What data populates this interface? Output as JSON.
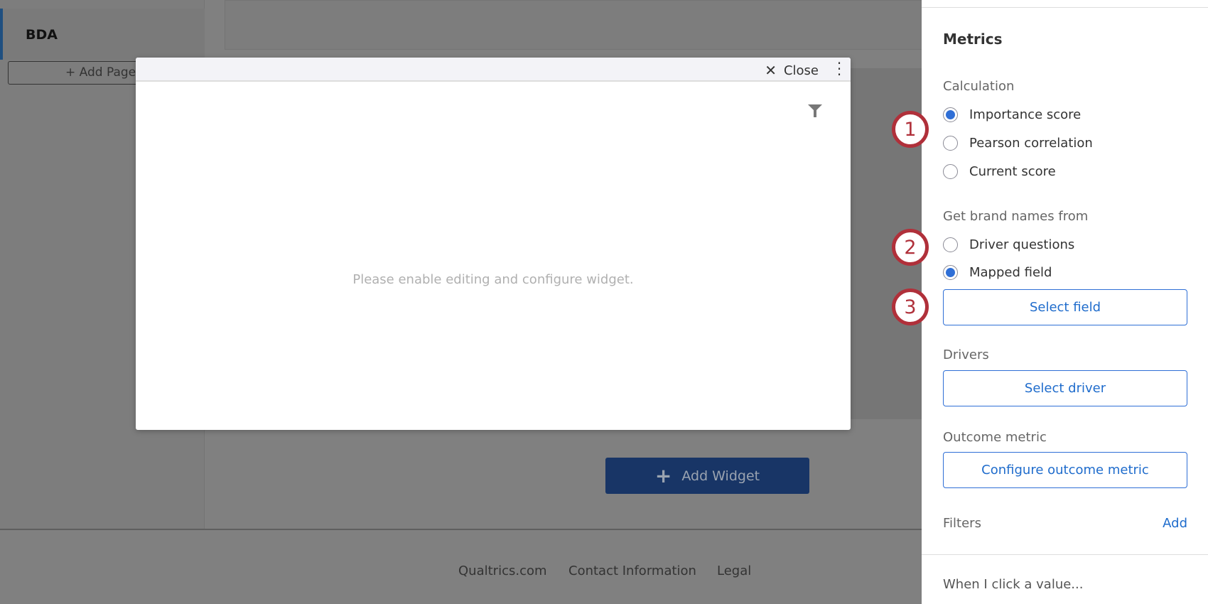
{
  "sidebar": {
    "active_page": "BDA",
    "add_page": "Add Page"
  },
  "main": {
    "add_widget": "Add Widget"
  },
  "footer": {
    "links": [
      "Qualtrics.com",
      "Contact Information",
      "Legal"
    ]
  },
  "modal": {
    "close": "Close",
    "message": "Please enable editing and configure widget."
  },
  "panel": {
    "title": "Metrics",
    "calculation_label": "Calculation",
    "calculation_options": [
      "Importance score",
      "Pearson correlation",
      "Current score"
    ],
    "calculation_selected": "Importance score",
    "brand_label": "Get brand names from",
    "brand_options": [
      "Driver questions",
      "Mapped field"
    ],
    "brand_selected": "Mapped field",
    "select_field": "Select field",
    "drivers_label": "Drivers",
    "select_driver": "Select driver",
    "outcome_label": "Outcome metric",
    "configure_outcome": "Configure outcome metric",
    "filters_label": "Filters",
    "filters_add": "Add",
    "click_label": "When I click a value..."
  },
  "callouts": [
    "1",
    "2",
    "3"
  ],
  "colors": {
    "accent": "#2f6fd6",
    "callout": "#b0303a",
    "add_widget_bg": "#183566"
  }
}
